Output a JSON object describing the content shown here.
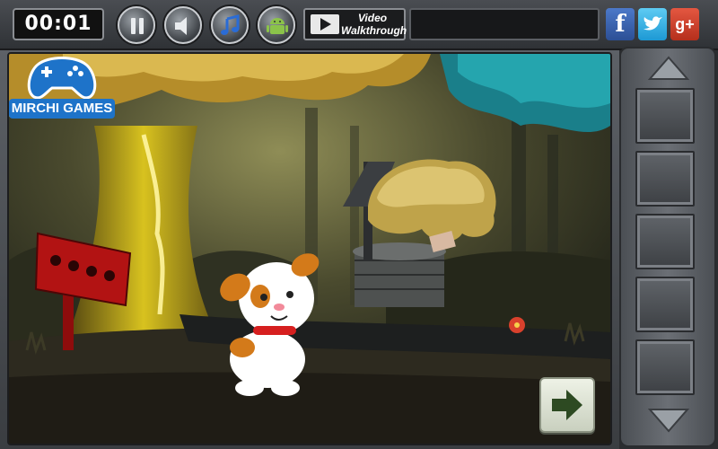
{
  "timer": {
    "value": "00:01"
  },
  "toolbar": {
    "video_line1": "Video",
    "video_line2": "Walkthrough"
  },
  "social": {
    "facebook_glyph": "f",
    "google_glyph": "g+"
  },
  "logo": {
    "text": "MIRCHI GAMES"
  },
  "icons": {
    "pause": "pause-icon",
    "sound": "speaker-icon",
    "music": "music-note-icon",
    "android": "android-icon",
    "video": "film-icon",
    "next": "arrow-right-icon"
  },
  "inventory": {
    "slots": [
      "",
      "",
      "",
      "",
      ""
    ]
  },
  "colors": {
    "accent_blue": "#1e73c9",
    "next_arrow": "#2d4a22",
    "dog_collar": "#d61f1f",
    "signpost": "#b21313"
  }
}
